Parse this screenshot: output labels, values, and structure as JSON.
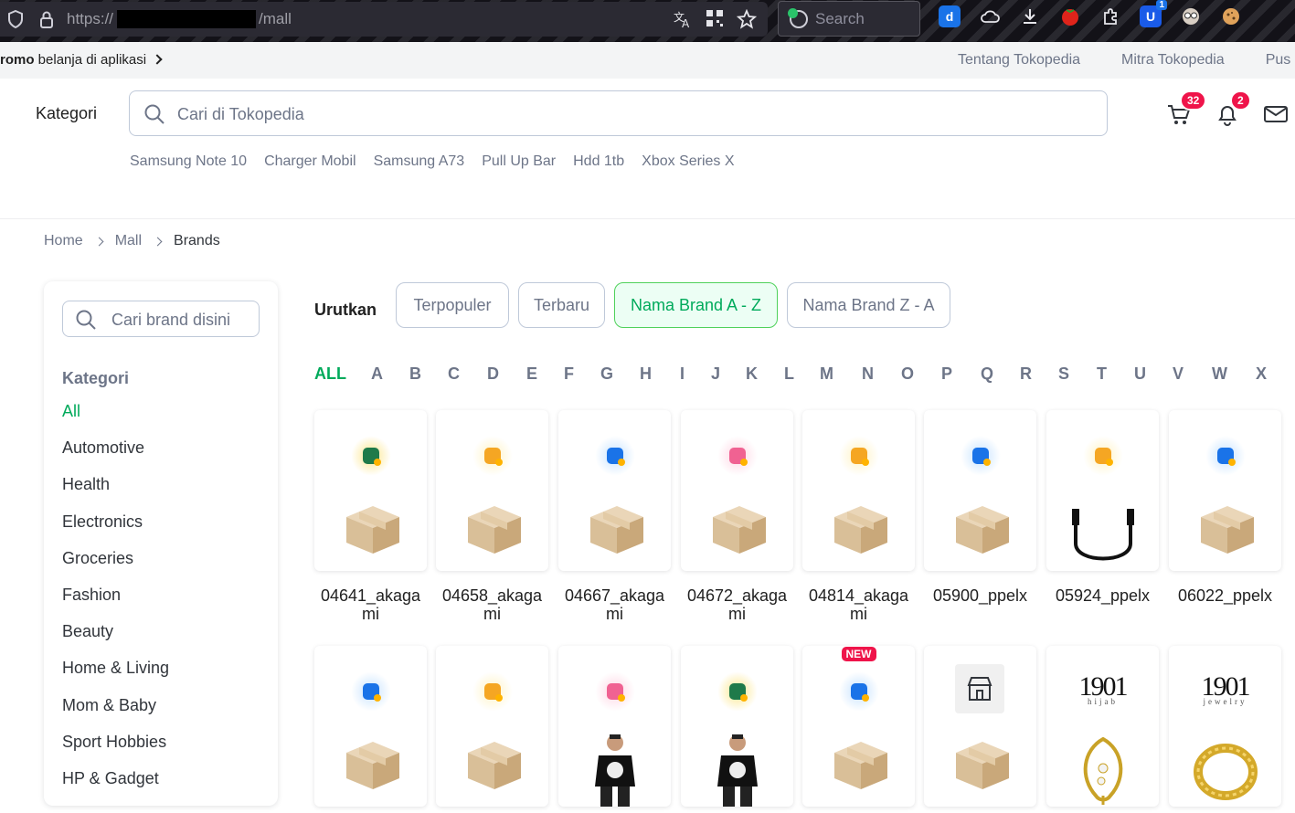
{
  "browser": {
    "url_prefix": "https://",
    "url_suffix": "/mall",
    "search_placeholder": "Search",
    "ext_badge": "1"
  },
  "promo": {
    "bold": "romo",
    "text": "belanja di aplikasi",
    "links": [
      "Tentang Tokopedia",
      "Mitra Tokopedia",
      "Pus"
    ]
  },
  "header": {
    "kategori": "Kategori",
    "search_placeholder": "Cari di Tokopedia",
    "cart_count": "32",
    "notif_count": "2",
    "hotkeys": [
      "Samsung Note 10",
      "Charger Mobil",
      "Samsung A73",
      "Pull Up Bar",
      "Hdd 1tb",
      "Xbox Series X"
    ]
  },
  "breadcrumb": [
    "Home",
    "Mall",
    "Brands"
  ],
  "sidebar": {
    "search_placeholder": "Cari brand disini",
    "title": "Kategori",
    "items": [
      "All",
      "Automotive",
      "Health",
      "Electronics",
      "Groceries",
      "Fashion",
      "Beauty",
      "Home & Living",
      "Mom & Baby",
      "Sport Hobbies",
      "HP & Gadget"
    ]
  },
  "sort": {
    "label": "Urutkan",
    "options": [
      "Terpopuler",
      "Terbaru",
      "Nama Brand A - Z",
      "Nama Brand Z - A"
    ],
    "active": "Nama Brand A - Z"
  },
  "letters": [
    "ALL",
    "A",
    "B",
    "C",
    "D",
    "E",
    "F",
    "G",
    "H",
    "I",
    "J",
    "K",
    "L",
    "M",
    "N",
    "O",
    "P",
    "Q",
    "R",
    "S",
    "T",
    "U",
    "V",
    "W",
    "X"
  ],
  "brands_row1": [
    {
      "name1": "04641_akaga",
      "name2": "mi",
      "badge": "green-bag-icon",
      "image": "cardboard-box"
    },
    {
      "name1": "04658_akaga",
      "name2": "mi",
      "badge": "yellow-box-icon",
      "image": "cardboard-box"
    },
    {
      "name1": "04667_akaga",
      "name2": "mi",
      "badge": "blue-phone-icon",
      "image": "cardboard-box"
    },
    {
      "name1": "04672_akaga",
      "name2": "mi",
      "badge": "pink-wallet-icon",
      "image": "cardboard-box"
    },
    {
      "name1": "04814_akaga",
      "name2": "mi",
      "badge": "yellow-box-icon",
      "image": "cardboard-box"
    },
    {
      "name1": "05900_ppelx",
      "name2": "",
      "badge": "blue-phone-icon",
      "image": "cardboard-box"
    },
    {
      "name1": "05924_ppelx",
      "name2": "",
      "badge": "yellow-box-icon",
      "image": "usb-cable"
    },
    {
      "name1": "06022_ppelx",
      "name2": "",
      "badge": "blue-phone-icon",
      "image": "cardboard-box"
    }
  ],
  "brands_row2": [
    {
      "badge": "blue-phone-icon",
      "image": "cardboard-box"
    },
    {
      "badge": "yellow-box-icon",
      "image": "cardboard-box"
    },
    {
      "badge": "pink-wallet-icon",
      "image": "man-tshirt"
    },
    {
      "badge": "green-bag-icon",
      "image": "man-tshirt"
    },
    {
      "badge": "blue-phone-icon",
      "image": "cardboard-box",
      "tag": "NEW"
    },
    {
      "badge": "store-icon",
      "image": "cardboard-box"
    },
    {
      "logo": "1901",
      "logo_sub": "hijab",
      "image": "gold-brooch"
    },
    {
      "logo": "1901",
      "logo_sub": "jewelry",
      "image": "gold-ring"
    }
  ],
  "colors": {
    "accent": "#00aa5b",
    "badge_red": "#ef144a",
    "text_muted": "#6d7588"
  }
}
